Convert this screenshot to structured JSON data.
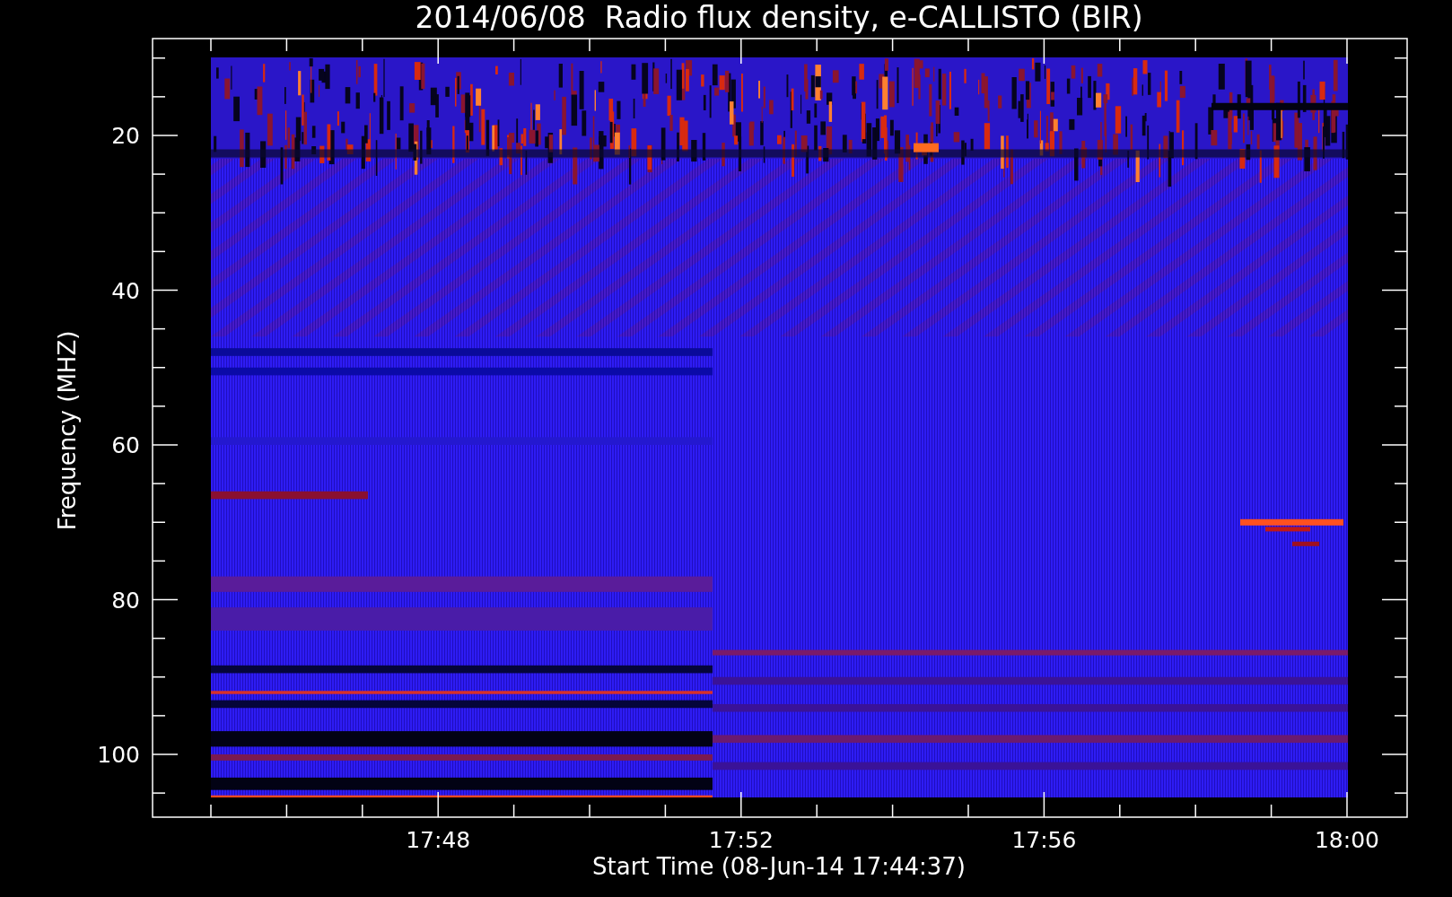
{
  "plot": {
    "title": "2014/06/08  Radio flux density, e-CALLISTO (BIR)",
    "ylabel": "Frequency (MHZ)",
    "xlabel": "Start Time (08-Jun-14 17:44:37)",
    "yticks": [
      "20",
      "40",
      "60",
      "80",
      "100"
    ],
    "xticks": [
      "17:48",
      "17:52",
      "17:56",
      "18:00"
    ]
  }
}
